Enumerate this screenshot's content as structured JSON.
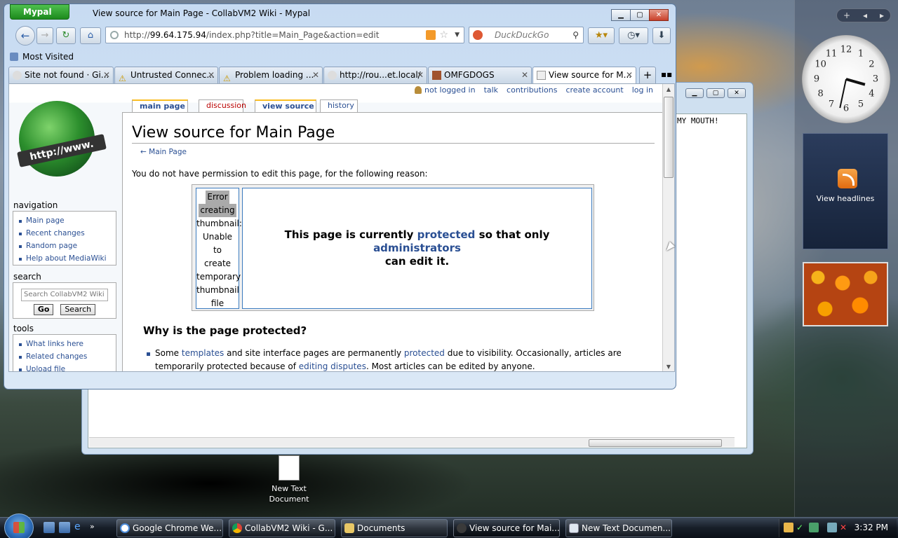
{
  "browser": {
    "app_button": "Mypal",
    "window_title": "View source for Main Page - CollabVM2 Wiki - Mypal",
    "url_prefix": "http://",
    "url_host": "99.64.175.94",
    "url_path": "/index.php?title=Main_Page&action=edit",
    "search_placeholder": "DuckDuckGo",
    "bookmark_item": "Most Visited",
    "tabs": [
      {
        "label": "Site not found · Gi..."
      },
      {
        "label": "Untrusted Connec..."
      },
      {
        "label": "Problem loading ..."
      },
      {
        "label": "http://rou...et.local/"
      },
      {
        "label": "OMFGDOGS"
      },
      {
        "label": "View source for M..."
      }
    ],
    "status_text": ""
  },
  "wiki": {
    "personal": {
      "not_logged_in": "not logged in",
      "talk": "talk",
      "contributions": "contributions",
      "create_account": "create account",
      "log_in": "log in"
    },
    "logo_text": "http://www.",
    "content_tabs": [
      "main page",
      "discussion",
      "view source",
      "history"
    ],
    "navigation_heading": "navigation",
    "navigation_items": [
      "Main page",
      "Recent changes",
      "Random page",
      "Help about MediaWiki"
    ],
    "search_heading": "search",
    "search_placeholder": "Search CollabVM2 Wiki",
    "go_button": "Go",
    "search_button": "Search",
    "tools_heading": "tools",
    "tools_items": [
      "What links here",
      "Related changes",
      "Upload file"
    ],
    "page_title": "View source for Main Page",
    "back_link": "← Main Page",
    "permission_text": "You do not have permission to edit this page, for the following reason:",
    "thumb_error_words": [
      "Error",
      "creating",
      "thumbnail:",
      "Unable",
      "to",
      "create",
      "temporary",
      "thumbnail",
      "file"
    ],
    "protected": {
      "part1": "This page is currently ",
      "link1": "protected",
      "part2": " so that only ",
      "link2": "administrators",
      "part3": " can edit it."
    },
    "why_heading": "Why is the page protected?",
    "why": {
      "t1": "Some ",
      "l1": "templates",
      "t2": " and site interface pages are permanently ",
      "l2": "protected",
      "t3": " due to visibility. Occasionally, articles are temporarily protected because of ",
      "l3": "editing disputes",
      "t4": ". Most articles can be edited by anyone."
    }
  },
  "back_window": {
    "text": "MY MOUTH!"
  },
  "desktop": {
    "icon_label": "New Text Document",
    "feed_gadget": "View headlines",
    "clock_numbers": [
      "12",
      "1",
      "2",
      "3",
      "4",
      "5",
      "6",
      "7",
      "8",
      "9",
      "10",
      "11"
    ]
  },
  "taskbar": {
    "buttons": [
      {
        "label": "Google Chrome We..."
      },
      {
        "label": "CollabVM2 Wiki - G..."
      },
      {
        "label": "Documents"
      },
      {
        "label": "View source for Mai..."
      },
      {
        "label": "New Text Documen..."
      }
    ],
    "time": "3:32 PM"
  },
  "colors": {
    "link": "#2a4f93",
    "accent_green": "#1c8a1c",
    "tab_highlight": "#fabd23"
  }
}
